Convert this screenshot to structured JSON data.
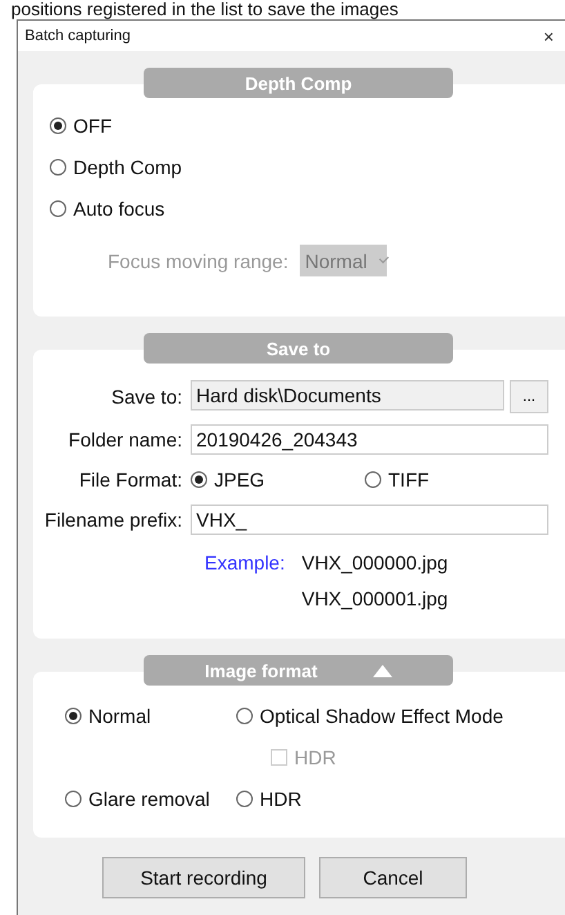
{
  "doc_text": "positions registered in the list to save the images",
  "window": {
    "title": "Batch capturing",
    "close": "×"
  },
  "depth_comp": {
    "title": "Depth Comp",
    "options": [
      {
        "label": "OFF",
        "selected": true
      },
      {
        "label": "Depth Comp",
        "selected": false
      },
      {
        "label": "Auto focus",
        "selected": false
      }
    ],
    "focus_range": {
      "label": "Focus moving range:",
      "value": "Normal",
      "disabled": true
    }
  },
  "save_to": {
    "title": "Save to",
    "fields": [
      {
        "kind": "path",
        "label": "Save to:",
        "value": "Hard disk\\Documents",
        "button": "..."
      },
      {
        "kind": "text",
        "label": "Folder name:",
        "value": "20190426_204343"
      },
      {
        "kind": "radio",
        "label": "File Format:",
        "options": [
          {
            "label": "JPEG",
            "selected": true
          },
          {
            "label": "TIFF",
            "selected": false
          }
        ]
      },
      {
        "kind": "text",
        "label": "Filename prefix:",
        "value": "VHX_"
      }
    ],
    "example": {
      "label": "Example:",
      "files": [
        "VHX_000000.jpg",
        "VHX_000001.jpg"
      ]
    }
  },
  "image_format": {
    "title": "Image format",
    "expanded": true,
    "options": [
      {
        "kind": "radio",
        "label": "Normal",
        "selected": true
      },
      {
        "kind": "radio",
        "label": "Optical Shadow Effect Mode",
        "selected": false
      },
      {
        "kind": "checkbox",
        "label": "HDR",
        "checked": false,
        "disabled": true
      },
      {
        "kind": "radio",
        "label": "Glare removal",
        "selected": false
      },
      {
        "kind": "radio",
        "label": "HDR",
        "selected": false
      }
    ]
  },
  "buttons": [
    "Start recording",
    "Cancel"
  ]
}
